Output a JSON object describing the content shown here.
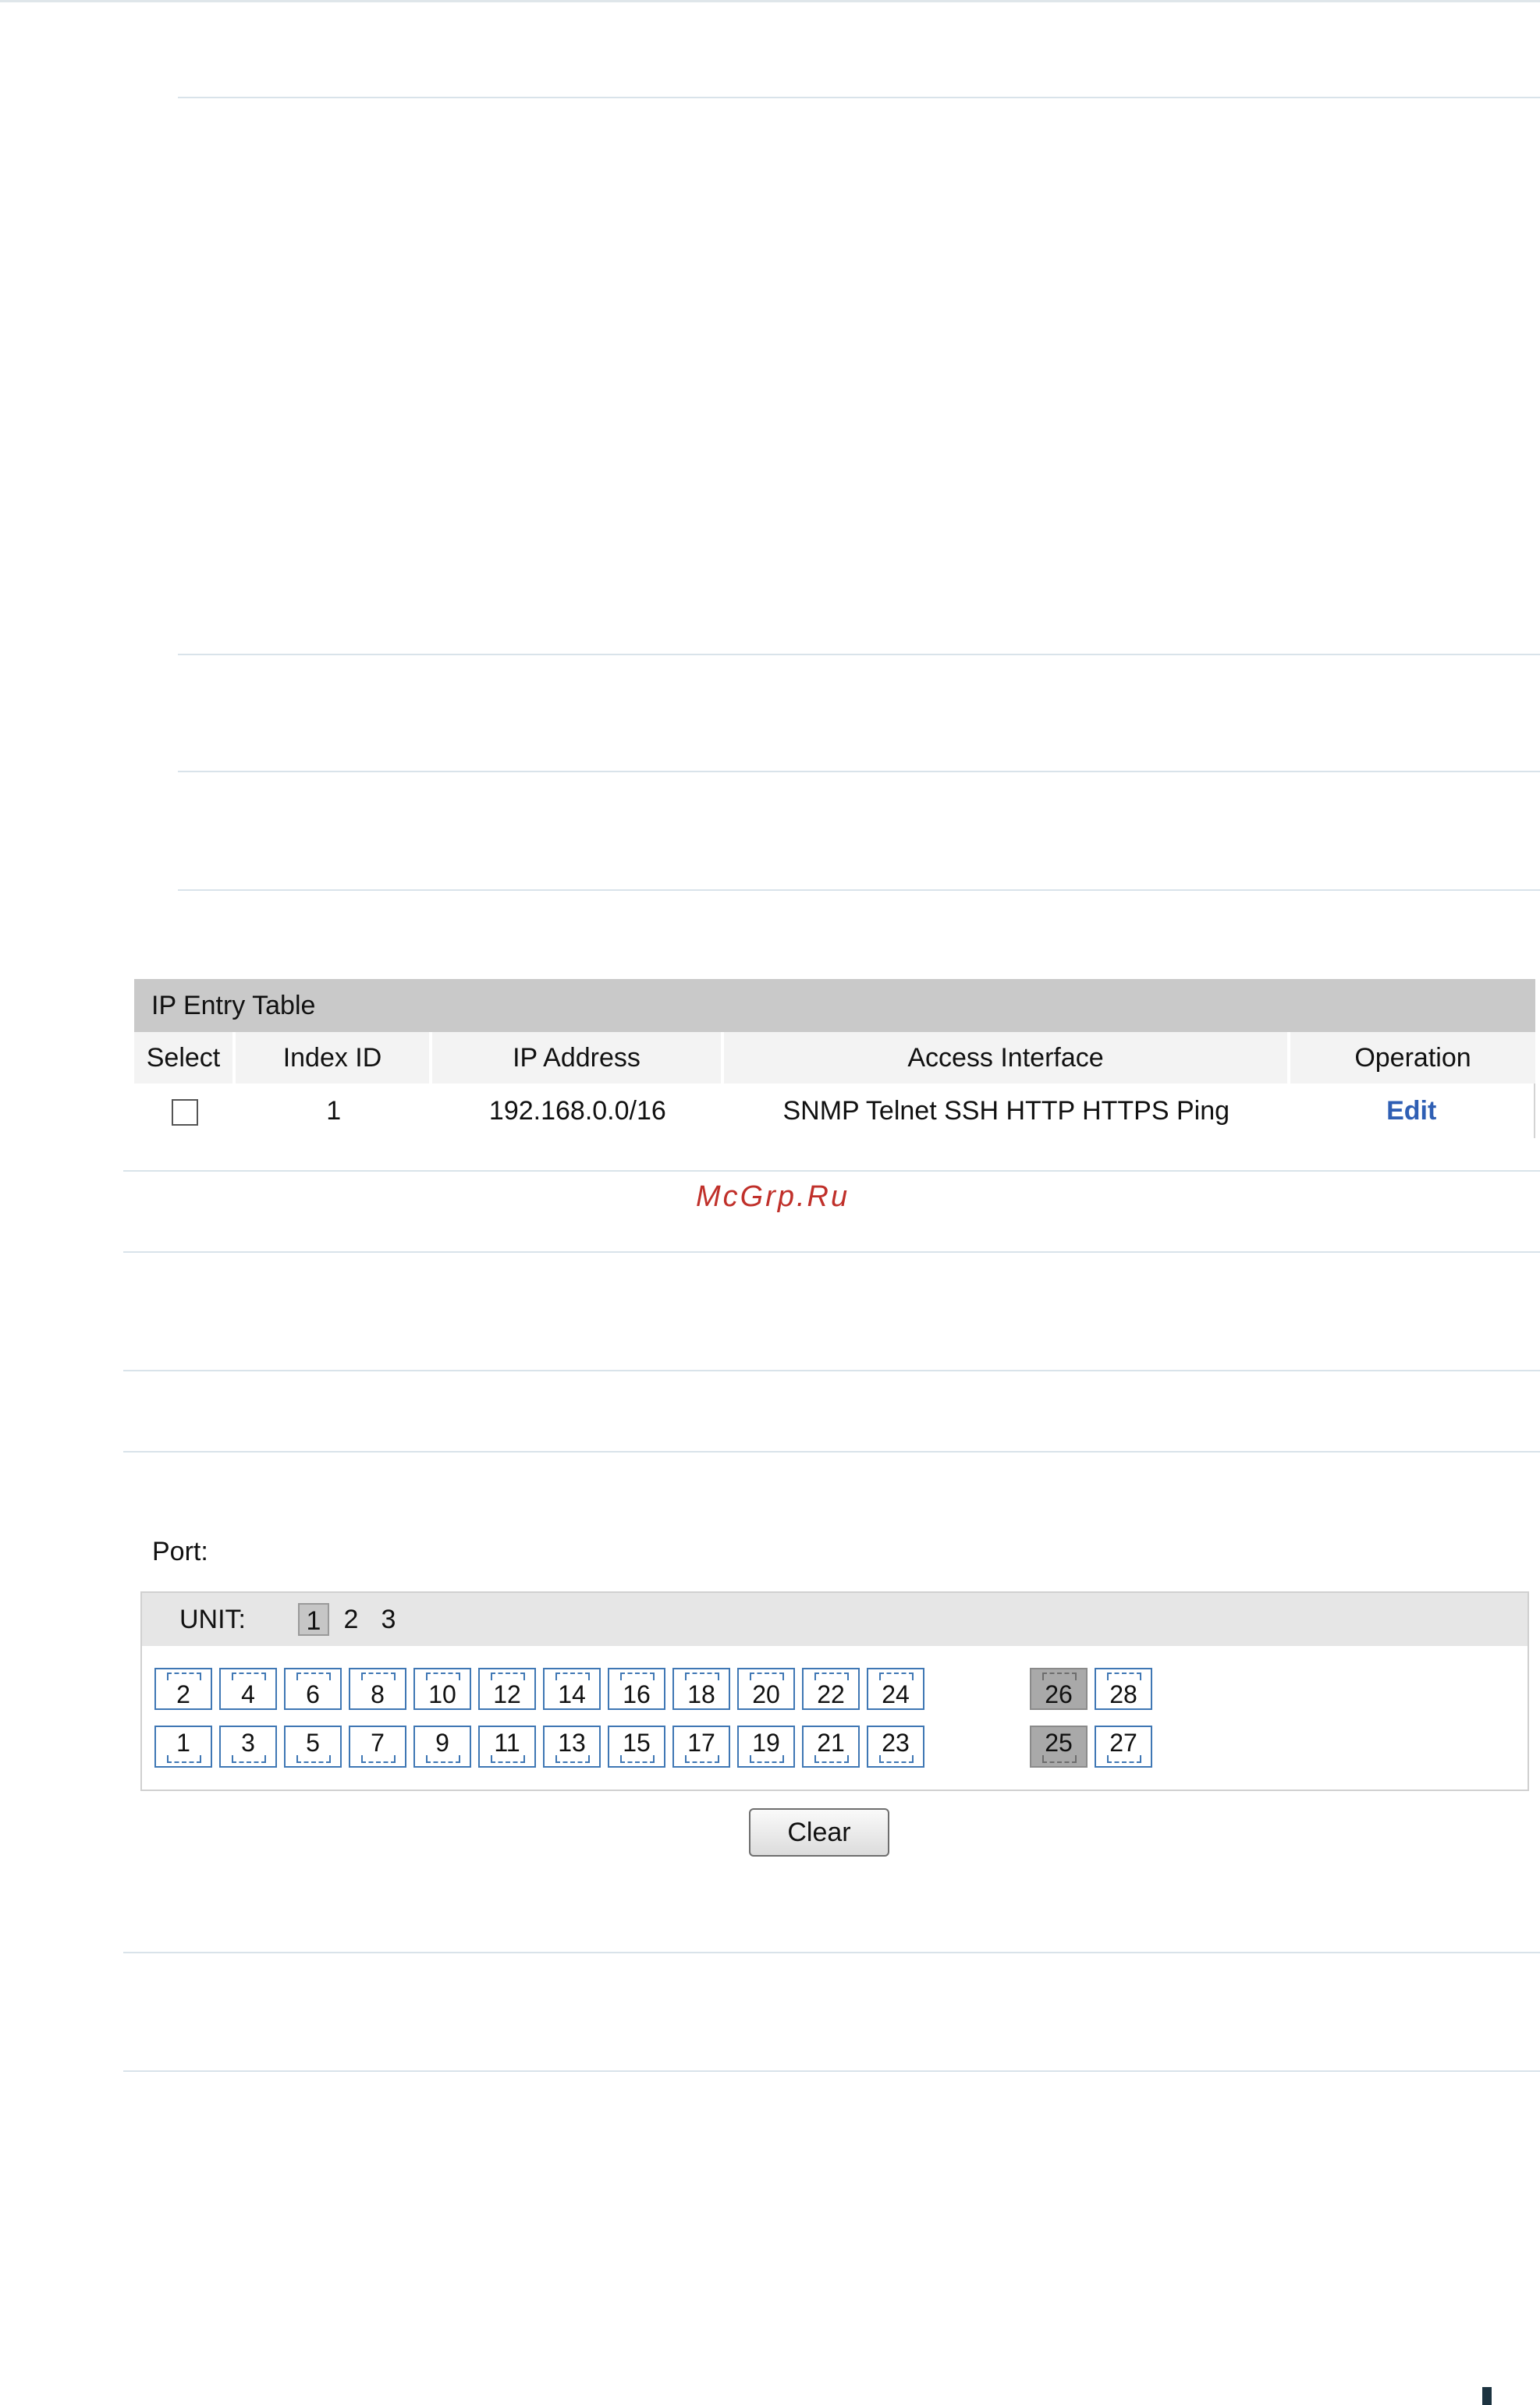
{
  "ip_table": {
    "title": "IP Entry Table",
    "columns": [
      "Select",
      "Index ID",
      "IP Address",
      "Access Interface",
      "Operation"
    ],
    "rows": [
      {
        "index_id": "1",
        "ip_address": "192.168.0.0/16",
        "access_interface": "SNMP Telnet SSH HTTP HTTPS Ping",
        "operation": "Edit",
        "selected": false
      }
    ]
  },
  "watermark": "McGrp.Ru",
  "port_panel": {
    "label": "Port:",
    "unit_label": "UNIT:",
    "units": [
      "1",
      "2",
      "3"
    ],
    "active_unit": "1",
    "ports_top": [
      "2",
      "4",
      "6",
      "8",
      "10",
      "12",
      "14",
      "16",
      "18",
      "20",
      "22",
      "24"
    ],
    "ports_bottom": [
      "1",
      "3",
      "5",
      "7",
      "9",
      "11",
      "13",
      "15",
      "17",
      "19",
      "21",
      "23"
    ],
    "sfp_top": [
      "26",
      "28"
    ],
    "sfp_bottom": [
      "25",
      "27"
    ],
    "highlighted": [
      "26",
      "25"
    ],
    "clear_label": "Clear"
  },
  "colors": {
    "port_border": "#3f77b4",
    "header_gray": "#c9c9c9",
    "link_blue": "#2f5fb4"
  }
}
